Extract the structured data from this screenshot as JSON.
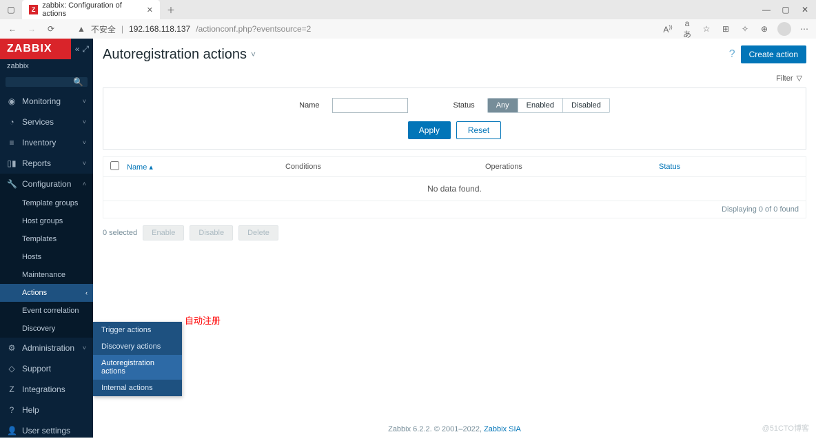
{
  "browser": {
    "tab_title": "zabbix: Configuration of actions",
    "security_label": "不安全",
    "url_host": "192.168.118.137",
    "url_path": "/actionconf.php?eventsource=2",
    "font_badge": "A",
    "translate_badge": "aあ"
  },
  "sidebar": {
    "logo": "ZABBIX",
    "brand": "zabbix",
    "nav": [
      {
        "icon": "◉",
        "label": "Monitoring",
        "chev": "˅"
      },
      {
        "icon": "◔",
        "label": "Services",
        "chev": "˅"
      },
      {
        "icon": "≡",
        "label": "Inventory",
        "chev": "˅"
      },
      {
        "icon": "▯▮",
        "label": "Reports",
        "chev": "˅"
      },
      {
        "icon": "🔧",
        "label": "Configuration",
        "chev": "˄",
        "expanded": true
      },
      {
        "icon": "⚙",
        "label": "Administration",
        "chev": "˅"
      }
    ],
    "config_sub": [
      "Template groups",
      "Host groups",
      "Templates",
      "Hosts",
      "Maintenance",
      "Actions",
      "Event correlation",
      "Discovery"
    ],
    "flyout": [
      "Trigger actions",
      "Discovery actions",
      "Autoregistration actions",
      "Internal actions"
    ],
    "annotation": "自动注册",
    "bottom": [
      {
        "icon": "◇",
        "label": "Support"
      },
      {
        "icon": "Z",
        "label": "Integrations"
      },
      {
        "icon": "?",
        "label": "Help"
      },
      {
        "icon": "👤",
        "label": "User settings"
      }
    ]
  },
  "page": {
    "title": "Autoregistration actions",
    "create_btn": "Create action",
    "filter_label": "Filter",
    "name_label": "Name",
    "status_label": "Status",
    "status_opts": [
      "Any",
      "Enabled",
      "Disabled"
    ],
    "apply": "Apply",
    "reset": "Reset",
    "cols": {
      "name": "Name ▴",
      "conditions": "Conditions",
      "operations": "Operations",
      "status": "Status"
    },
    "no_data": "No data found.",
    "display_count": "Displaying 0 of 0 found",
    "selected": "0 selected",
    "bulk": [
      "Enable",
      "Disable",
      "Delete"
    ],
    "footer_version": "Zabbix 6.2.2. © 2001–2022, ",
    "footer_link": "Zabbix SIA",
    "watermark": "@51CTO博客"
  }
}
